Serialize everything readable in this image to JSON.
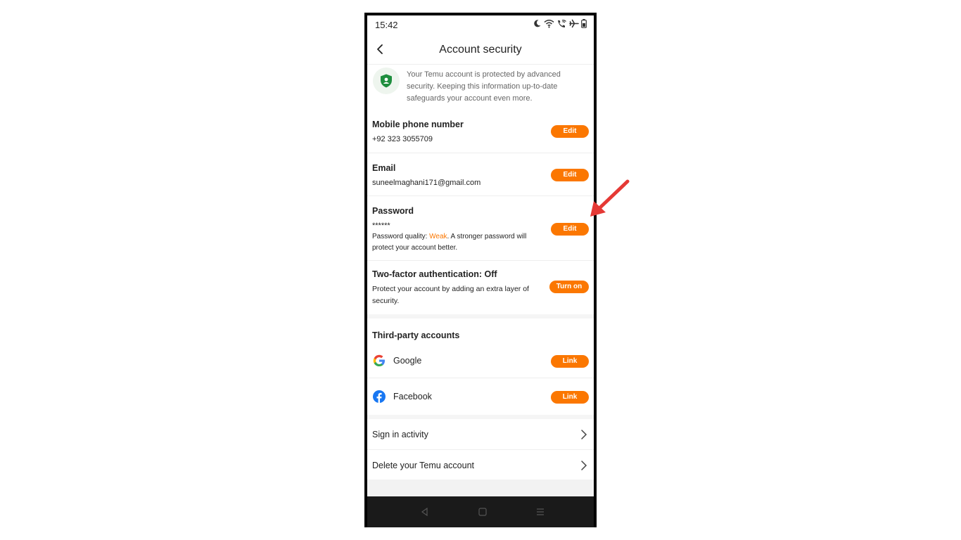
{
  "status_bar": {
    "time": "15:42",
    "icons": [
      "moon-icon",
      "wifi-icon",
      "wifi-calling-icon",
      "airplane-icon",
      "battery-icon"
    ]
  },
  "header": {
    "title": "Account security",
    "back_icon": "chevron-left-icon"
  },
  "notice": {
    "icon": "shield-user-icon",
    "text": "Your Temu account is protected by advanced security. Keeping this information up-to-date safeguards your account even more."
  },
  "mobile": {
    "title": "Mobile phone number",
    "value": "+92 323 3055709",
    "button": "Edit"
  },
  "email": {
    "title": "Email",
    "value": "suneelmaghani171@gmail.com",
    "button": "Edit"
  },
  "password": {
    "title": "Password",
    "value": "******",
    "quality_prefix": "Password quality: ",
    "quality_value": "Weak",
    "quality_suffix": ". A stronger password will protect your account better.",
    "button": "Edit"
  },
  "two_factor": {
    "title": "Two-factor authentication: Off",
    "desc": "Protect your account by adding an extra layer of security.",
    "button": "Turn on"
  },
  "third_party": {
    "title": "Third-party accounts",
    "accounts": [
      {
        "name": "Google",
        "icon": "google-icon",
        "button": "Link"
      },
      {
        "name": "Facebook",
        "icon": "facebook-icon",
        "button": "Link"
      }
    ]
  },
  "links": [
    {
      "label": "Sign in activity"
    },
    {
      "label": "Delete your Temu account"
    }
  ],
  "nav_bar": {
    "buttons": [
      "back-triangle-icon",
      "home-square-icon",
      "menu-icon"
    ]
  },
  "colors": {
    "accent": "#fb7701",
    "shield": "#1e8e3e",
    "annotation_arrow": "#e53935"
  }
}
